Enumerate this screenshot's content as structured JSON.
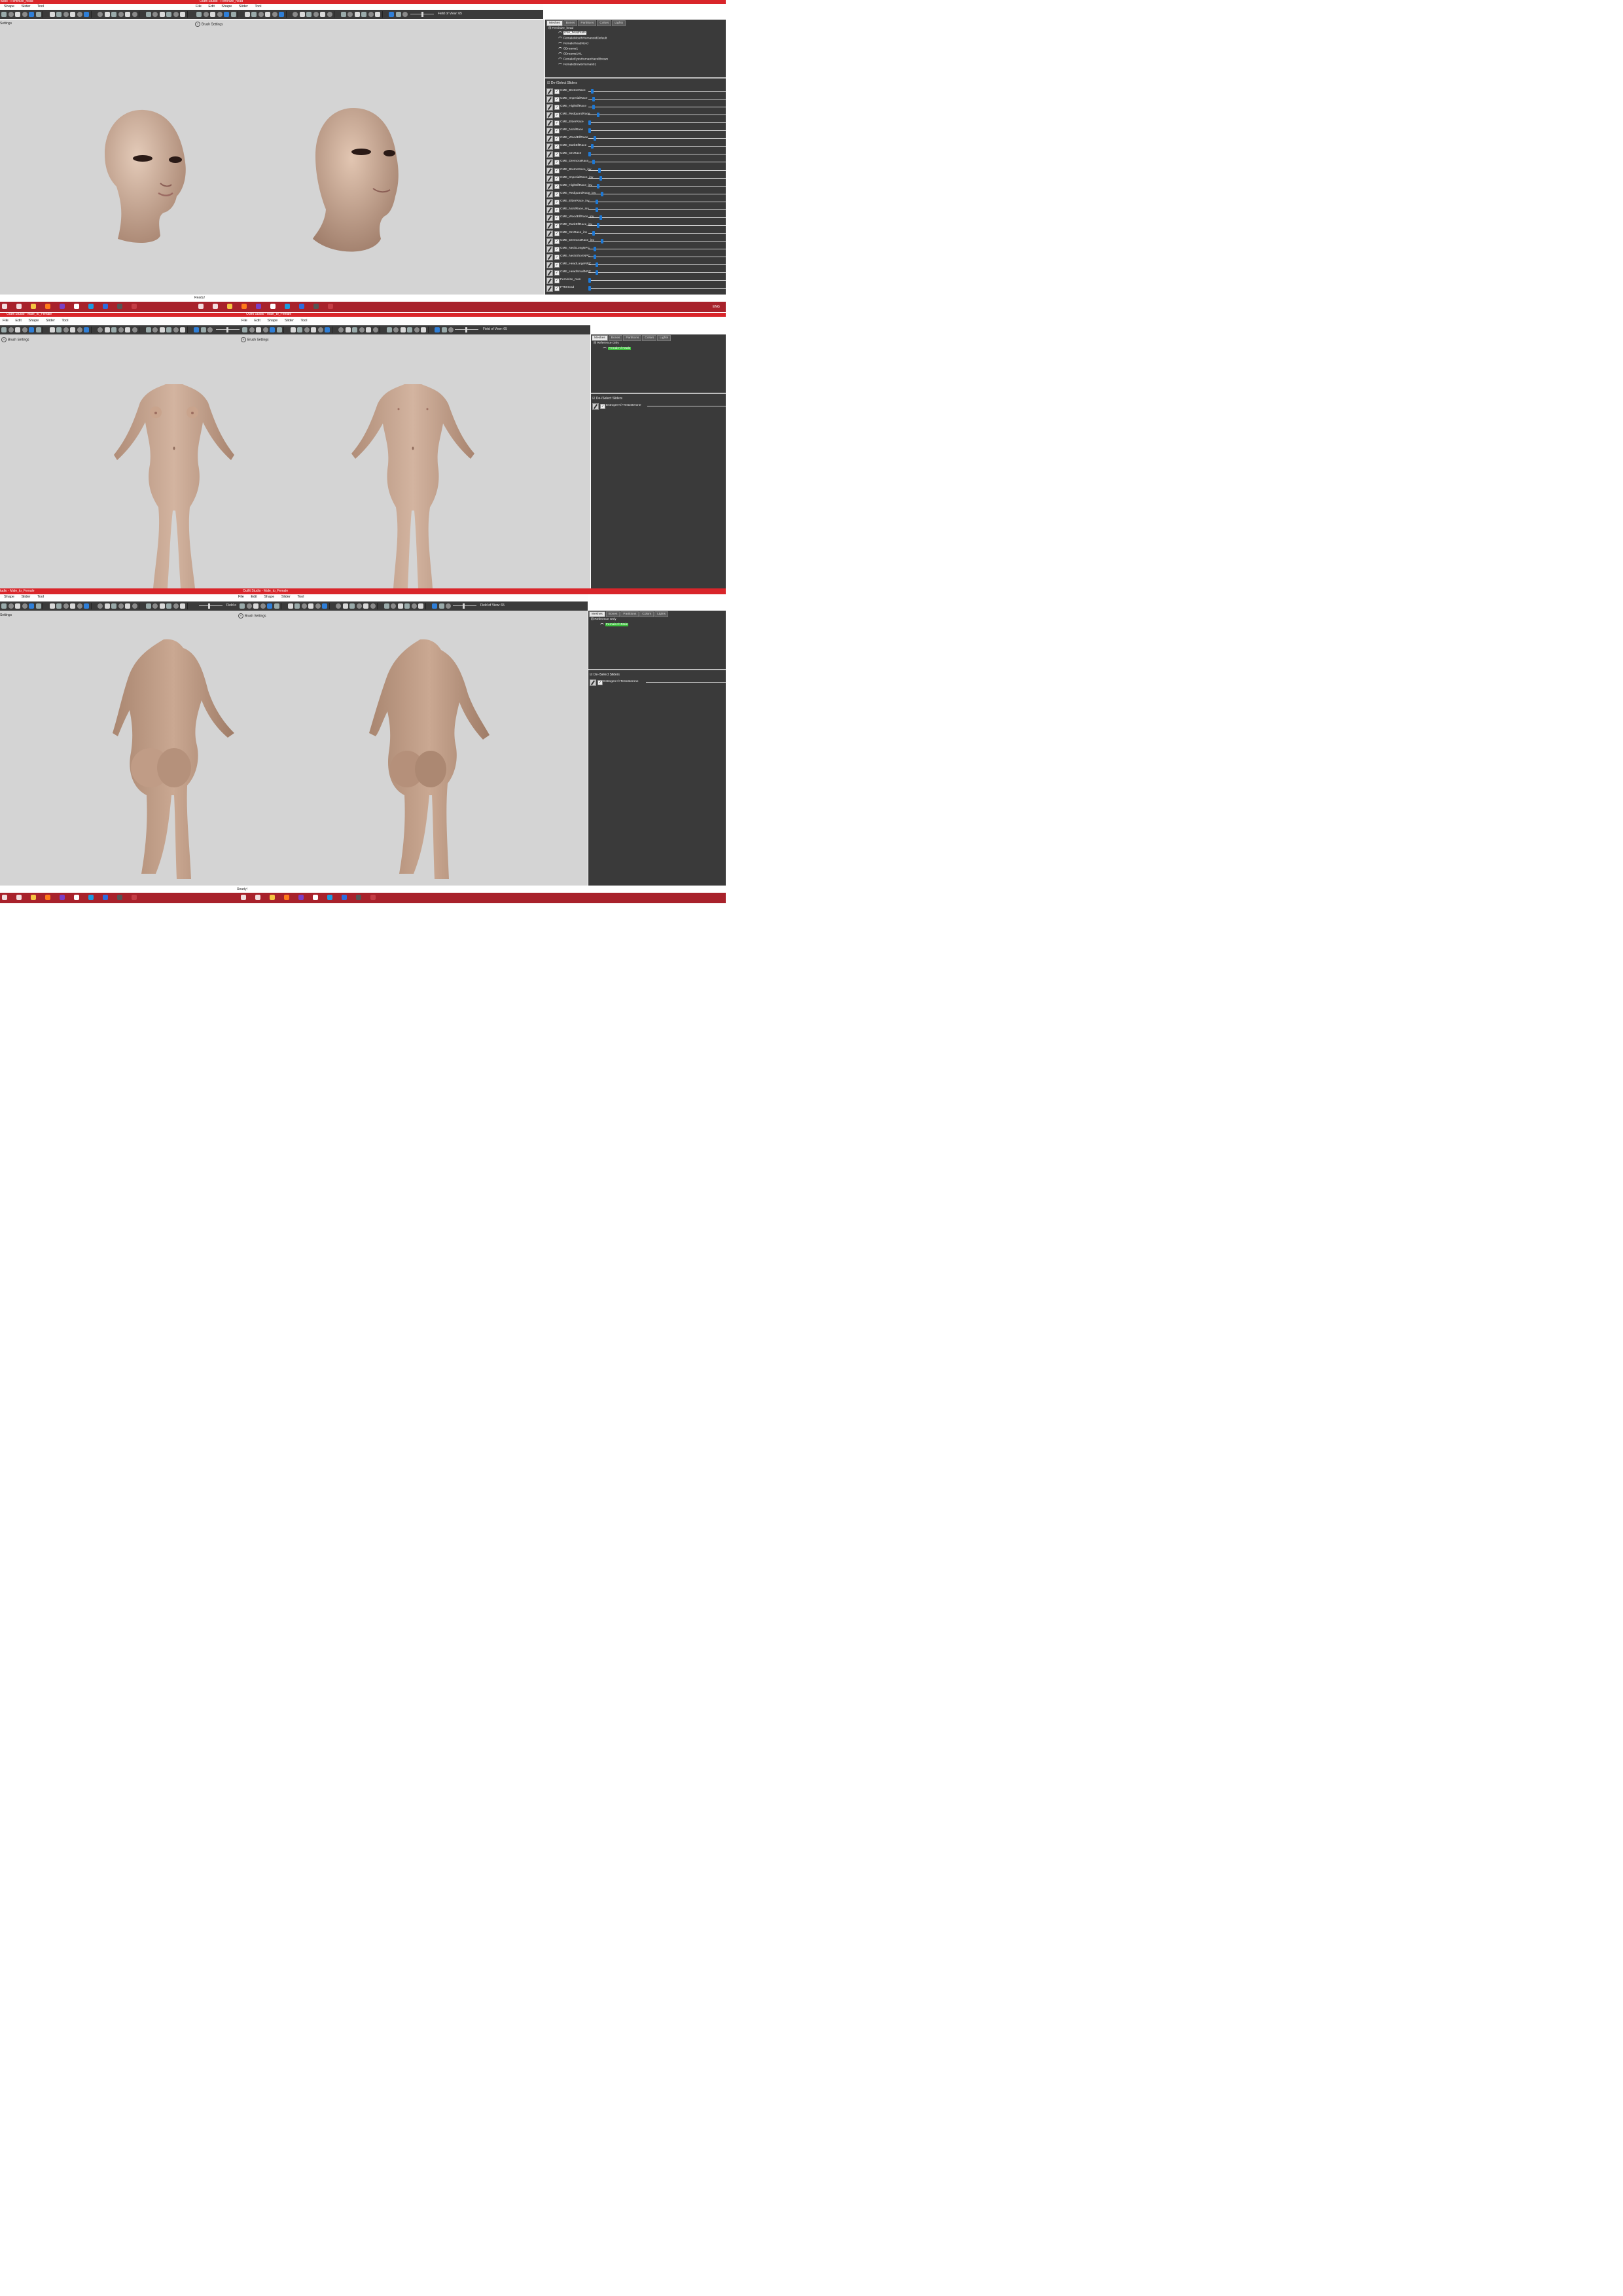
{
  "win1": {
    "left_title": "tudio - Feminize_head",
    "right_title": "Outfit Studio - Feminize_head",
    "left_menu": [
      "Shape",
      "Slider",
      "Tool"
    ],
    "right_menu": [
      "File",
      "Edit",
      "Shape",
      "Slider",
      "Tool"
    ],
    "fov": "Field of View: 65",
    "left_brush": "Settings",
    "right_brush": "Brush Settings",
    "status": "Ready!",
    "tabs": [
      "Meshes",
      "Bones",
      "Partitions",
      "Colors",
      "Lights"
    ],
    "tree_root": "Feminize_head",
    "tree": [
      "cme_headmale",
      "FemaleMouthHumanoidDefault",
      "FemaleHeadNord",
      "0Dreams1",
      "0Dreams1HL",
      "FemaleEyesHumanHazelBrown",
      "FemaleBrowsHuman01"
    ],
    "sliders_header": "De-/Select Sliders",
    "sliders": [
      {
        "name": "CME_BretonRace",
        "value": 0.02
      },
      {
        "name": "CME_ImperialRace",
        "value": 0.03
      },
      {
        "name": "CME_HighElfRace",
        "value": 0.03
      },
      {
        "name": "CME_RedguardRace",
        "value": 0.06
      },
      {
        "name": "CME_ElderRace",
        "value": 0.0
      },
      {
        "name": "CME_NordRace",
        "value": 0.0
      },
      {
        "name": "CME_WoodElfRace",
        "value": 0.04
      },
      {
        "name": "CME_DarkElfRace",
        "value": 0.02
      },
      {
        "name": "CME_OrcRace",
        "value": 0.0
      },
      {
        "name": "CME_DremoraRace",
        "value": 0.03
      },
      {
        "name": "CME_BretonRace_inv",
        "value": 0.07
      },
      {
        "name": "CME_ImperialRace_inv",
        "value": 0.08
      },
      {
        "name": "CME_HighElfRace_inv",
        "value": 0.06
      },
      {
        "name": "CME_RedguardRace_inv",
        "value": 0.09
      },
      {
        "name": "CME_ElderRace_inv",
        "value": 0.05
      },
      {
        "name": "CME_NordRace_inv",
        "value": 0.05
      },
      {
        "name": "CME_WoodElfRace_inv",
        "value": 0.08
      },
      {
        "name": "CME_DarkElfRace_inv",
        "value": 0.06
      },
      {
        "name": "CME_OrcRace_inv",
        "value": 0.03
      },
      {
        "name": "CME_DremoraRace_inv",
        "value": 0.09
      },
      {
        "name": "CME_NeckLongNPC",
        "value": 0.04
      },
      {
        "name": "CME_NeckShortNPC",
        "value": 0.04
      },
      {
        "name": "CME_HeadLargeNPC",
        "value": 0.05
      },
      {
        "name": "CME_HeadSmallNPC",
        "value": 0.05
      },
      {
        "name": "Feminize_man",
        "value": 0.0
      },
      {
        "name": "FTMHead",
        "value": 0.0
      }
    ]
  },
  "taskbar_tray": {
    "lang": "ENG"
  },
  "win2": {
    "left_title": "Outfit Studio - Male_to_Female",
    "right_title": "Outfit Studio - Male_to_Female",
    "left_menu": [
      "File",
      "Edit",
      "Shape",
      "Slider",
      "Tool"
    ],
    "right_menu": [
      "File",
      "Edit",
      "Shape",
      "Slider",
      "Tool"
    ],
    "fov": "Field of View: 65",
    "left_brush": "Brush Settings",
    "right_brush": "Brush Settings",
    "tabs": [
      "Meshes",
      "Bones",
      "Partitions",
      "Colors",
      "Lights"
    ],
    "tree_root": "Reference Only",
    "tree_item": "Female</>Male",
    "sliders_header": "De-/Select Sliders",
    "slider": {
      "name": "Estrogen</>Testosterone",
      "value": 0.0
    }
  },
  "win3": {
    "left_title": "tudio - Male_to_Female",
    "right_title": "Outfit Studio - Male_to_Female",
    "left_menu": [
      "Shape",
      "Slider",
      "Tool"
    ],
    "right_menu": [
      "File",
      "Edit",
      "Shape",
      "Slider",
      "Tool"
    ],
    "left_fov": "Field o",
    "fov": "Field of View: 65",
    "left_brush": "Settings",
    "right_brush": "Brush Settings",
    "status": "Ready!",
    "tabs": [
      "Meshes",
      "Bones",
      "Partitions",
      "Colors",
      "Lights"
    ],
    "tree_root": "Reference Only",
    "tree_item": "Female</>Male",
    "sliders_header": "De-/Select Sliders",
    "slider": {
      "name": "Estrogen</>Testosterone",
      "value": 0.0
    }
  },
  "colors": {
    "titlebar": "#d9252a",
    "taskbar": "#a8222b",
    "viewport": "#d4d4d4",
    "panel": "#3a3a3a",
    "toolbar": "#3b3b3b",
    "slider_knob": "#1e79d6",
    "skin": "#c9a48d"
  }
}
